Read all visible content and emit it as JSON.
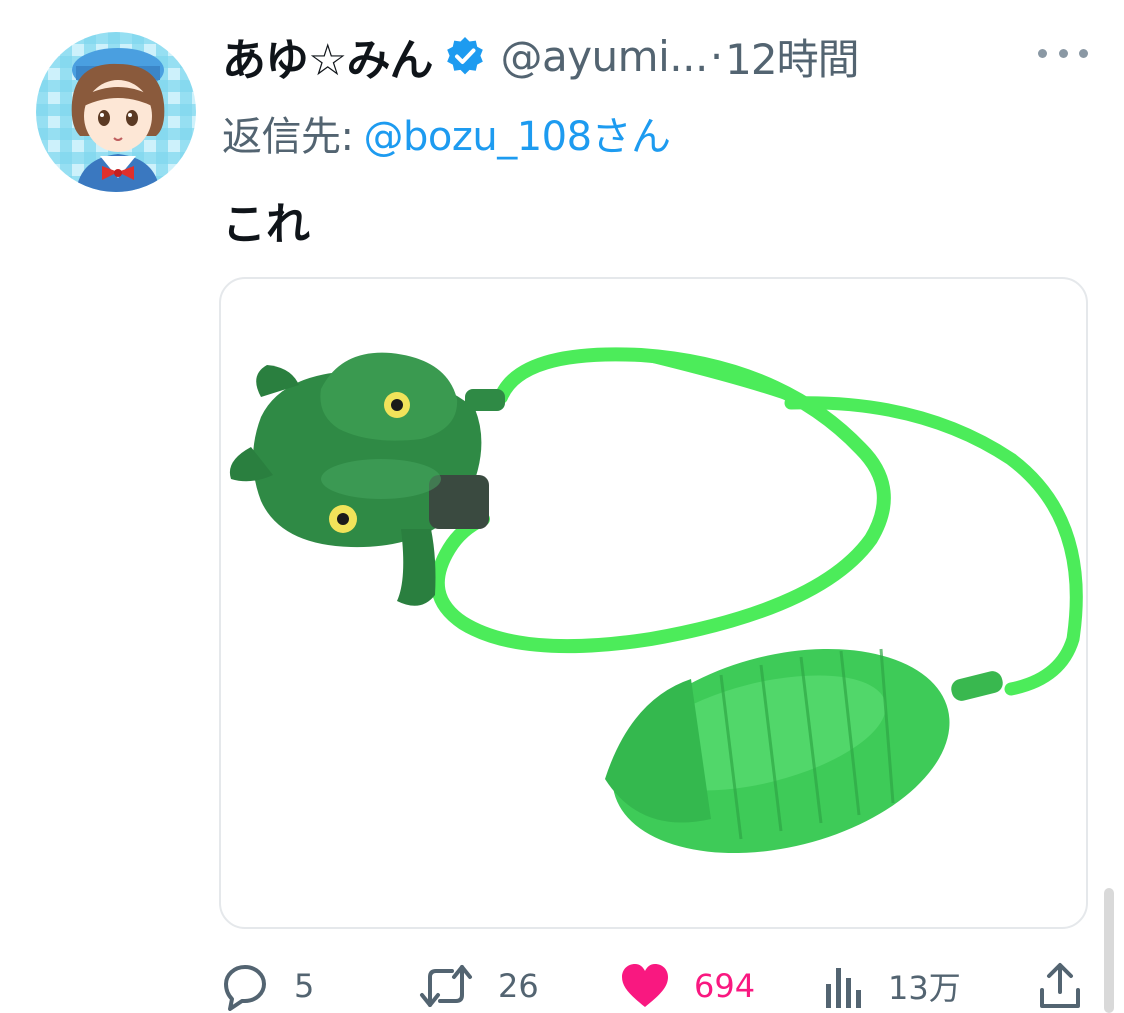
{
  "tweet": {
    "display_name": "あゆ☆みん",
    "handle": "@ayumi...",
    "separator": "·",
    "time": "12時間",
    "reply_prefix": "返信先:",
    "reply_target": "@bozu_108さん",
    "text": "これ",
    "avatar_signature": "Ayumin"
  },
  "actions": {
    "replies": "5",
    "retweets": "26",
    "likes": "694",
    "views": "13万"
  },
  "colors": {
    "link": "#1d9bf0",
    "secondary_text": "#536471",
    "like": "#f91880",
    "verified": "#1d9bf0",
    "toy_green": "#2e8b45",
    "tube_green": "#4cec5a"
  },
  "icons": [
    "verified-badge-icon",
    "more-icon",
    "reply-icon",
    "retweet-icon",
    "like-icon",
    "views-icon",
    "share-icon"
  ]
}
